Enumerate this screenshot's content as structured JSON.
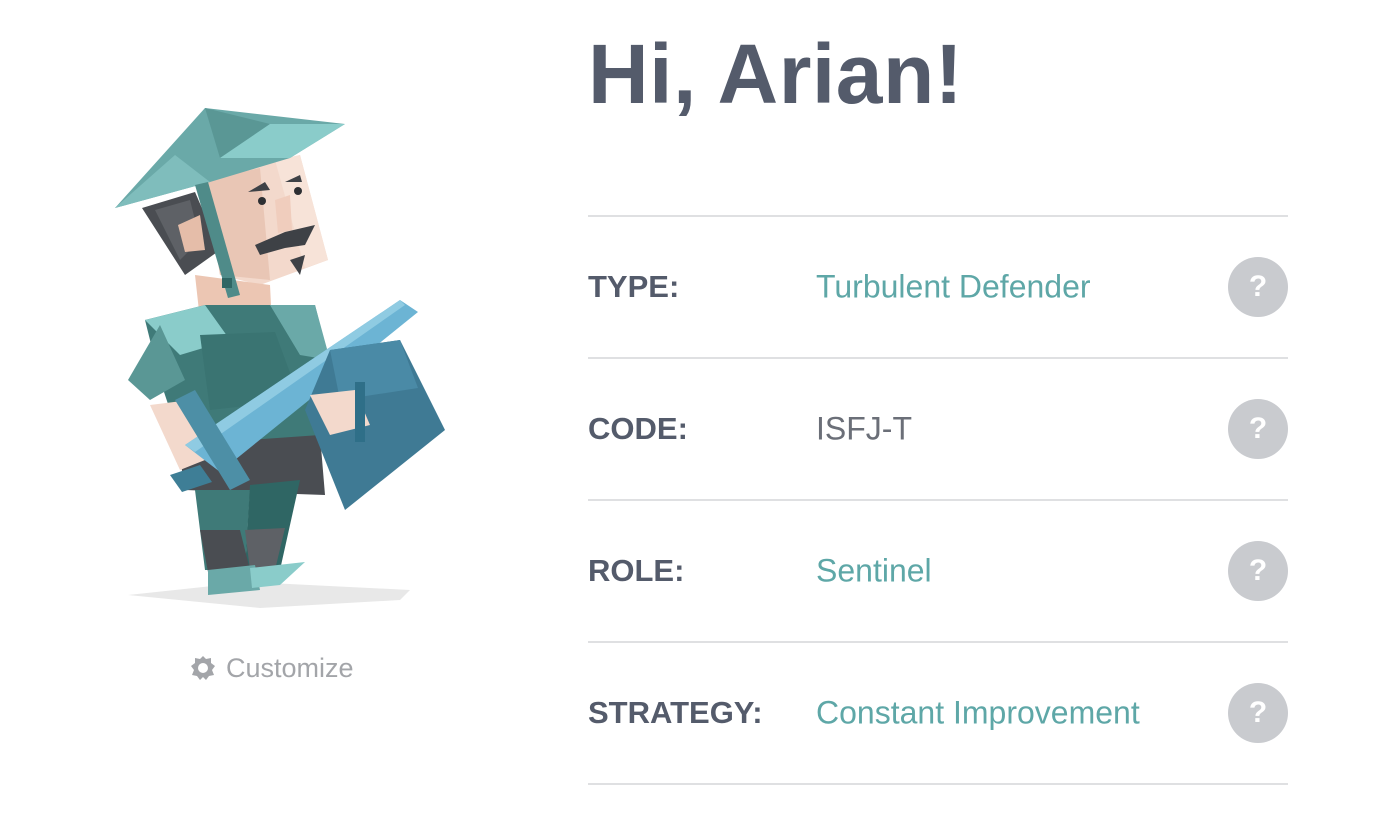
{
  "greeting": "Hi, Arian!",
  "customize": {
    "label": "Customize",
    "icon": "gear-icon"
  },
  "profile": [
    {
      "key": "type",
      "label": "TYPE:",
      "value": "Turbulent Defender",
      "style": "link",
      "help": "?"
    },
    {
      "key": "code",
      "label": "CODE:",
      "value": "ISFJ-T",
      "style": "plain",
      "help": "?"
    },
    {
      "key": "role",
      "label": "ROLE:",
      "value": "Sentinel",
      "style": "link",
      "help": "?"
    },
    {
      "key": "strategy",
      "label": "STRATEGY:",
      "value": "Constant Improvement",
      "style": "link",
      "help": "?"
    }
  ],
  "colors": {
    "heading": "#545b6b",
    "accent": "#5ea7a7",
    "muted": "#a3a5a9",
    "help_bg": "#c9cbcf",
    "divider": "#dfe0e2"
  }
}
